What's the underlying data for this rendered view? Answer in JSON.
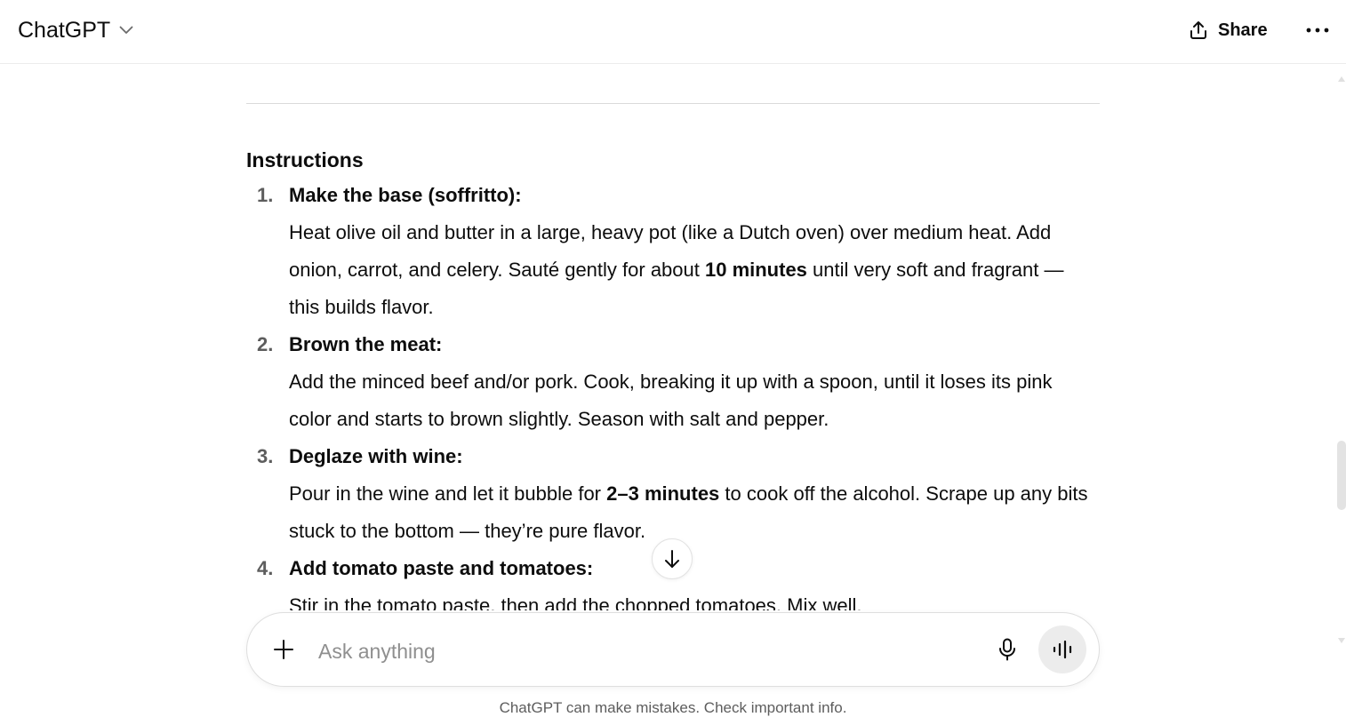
{
  "header": {
    "model_name": "ChatGPT",
    "share_label": "Share"
  },
  "content": {
    "section_title": "Instructions",
    "steps": [
      {
        "number": "1.",
        "title": "Make the base (soffritto):",
        "body_parts": [
          "Heat olive oil and butter in a large, heavy pot (like a Dutch oven) over medium heat. Add onion, carrot, and celery. Sauté gently for about ",
          "10 minutes",
          " until very soft and fragrant — this builds flavor."
        ]
      },
      {
        "number": "2.",
        "title": "Brown the meat:",
        "body_parts": [
          "Add the minced beef and/or pork. Cook, breaking it up with a spoon, until it loses its pink color and starts to brown slightly. Season with salt and pepper."
        ]
      },
      {
        "number": "3.",
        "title": "Deglaze with wine:",
        "body_parts": [
          "Pour in the wine and let it bubble for ",
          "2–3 minutes",
          " to cook off the alcohol. Scrape up any bits stuck to the bottom — they’re pure flavor."
        ]
      },
      {
        "number": "4.",
        "title": "Add tomato paste and tomatoes:",
        "body_parts": [
          "Stir in the tomato paste, then add the chopped tomatoes. Mix well."
        ]
      }
    ]
  },
  "composer": {
    "placeholder": "Ask anything",
    "value": ""
  },
  "footer": {
    "disclaimer": "ChatGPT can make mistakes. Check important info."
  },
  "icons": {
    "model_chevron": "chevron-down-icon",
    "share": "upload-icon",
    "more": "more-horizontal-icon",
    "scroll_down": "arrow-down-icon",
    "attach": "plus-icon",
    "dictate": "microphone-icon",
    "voice": "voice-mode-icon"
  }
}
